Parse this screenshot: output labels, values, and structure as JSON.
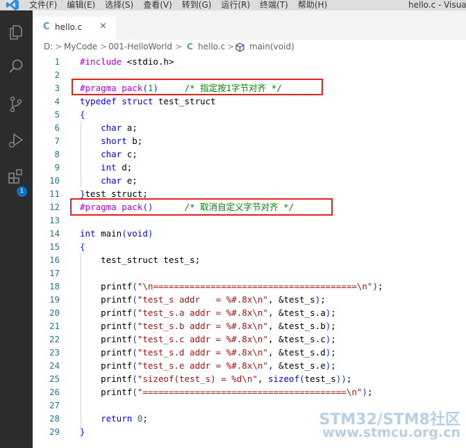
{
  "menubar": {
    "items": [
      "文件(F)",
      "编辑(E)",
      "选择(S)",
      "查看(V)",
      "转到(G)",
      "运行(R)",
      "终端(T)",
      "帮助(H)"
    ],
    "window_title": "hello.c - Visual S"
  },
  "activity": {
    "icons": [
      "explorer-icon",
      "search-icon",
      "source-control-icon",
      "run-debug-icon",
      "extensions-icon"
    ],
    "extensions_badge": "1"
  },
  "tab": {
    "label": "hello.c",
    "icon_letter": "C",
    "close_glyph": "×"
  },
  "breadcrumb": {
    "items": [
      "D:",
      "MyCode",
      "001-HelloWorld",
      "hello.c",
      "main(void)"
    ],
    "separator": ">"
  },
  "editor": {
    "line_numbers": [
      "1",
      "2",
      "3",
      "4",
      "5",
      "6",
      "7",
      "8",
      "9",
      "10",
      "11",
      "12",
      "13",
      "14",
      "15",
      "16",
      "17",
      "18",
      "19",
      "20",
      "21",
      "22",
      "23",
      "24",
      "25",
      "26",
      "27",
      "28",
      "29"
    ],
    "lines": [
      "#include <stdio.h>",
      "",
      "#pragma pack(1)     /* 指定按1字节对齐 */",
      "typedef struct test_struct",
      "{",
      "    char a;",
      "    short b;",
      "    char c;",
      "    int d;",
      "    char e;",
      "}test_struct;",
      "#pragma pack()      /* 取消自定义字节对齐 */",
      "",
      "int main(void)",
      "{",
      "    test_struct test_s;",
      "",
      "    printf(\"\\n=======================================\\n\");",
      "    printf(\"test_s addr   = %#.8x\\n\", &test_s);",
      "    printf(\"test_s.a addr = %#.8x\\n\", &test_s.a);",
      "    printf(\"test_s.b addr = %#.8x\\n\", &test_s.b);",
      "    printf(\"test_s.c addr = %#.8x\\n\", &test_s.c);",
      "    printf(\"test_s.d addr = %#.8x\\n\", &test_s.d);",
      "    printf(\"test_s.e addr = %#.8x\\n\", &test_s.e);",
      "    printf(\"sizeof(test_s) = %d\\n\", sizeof(test_s));",
      "    printf(\"=======================================\\n\");",
      "",
      "    return 0;",
      "}"
    ]
  },
  "watermark": {
    "line1": "STM32/STM8社区",
    "line2": "www.stmcu.org.cn"
  },
  "colors": {
    "highlight_box": "#e0231c",
    "activity_bar": "#2c2c2c",
    "badge": "#0e70c0"
  }
}
